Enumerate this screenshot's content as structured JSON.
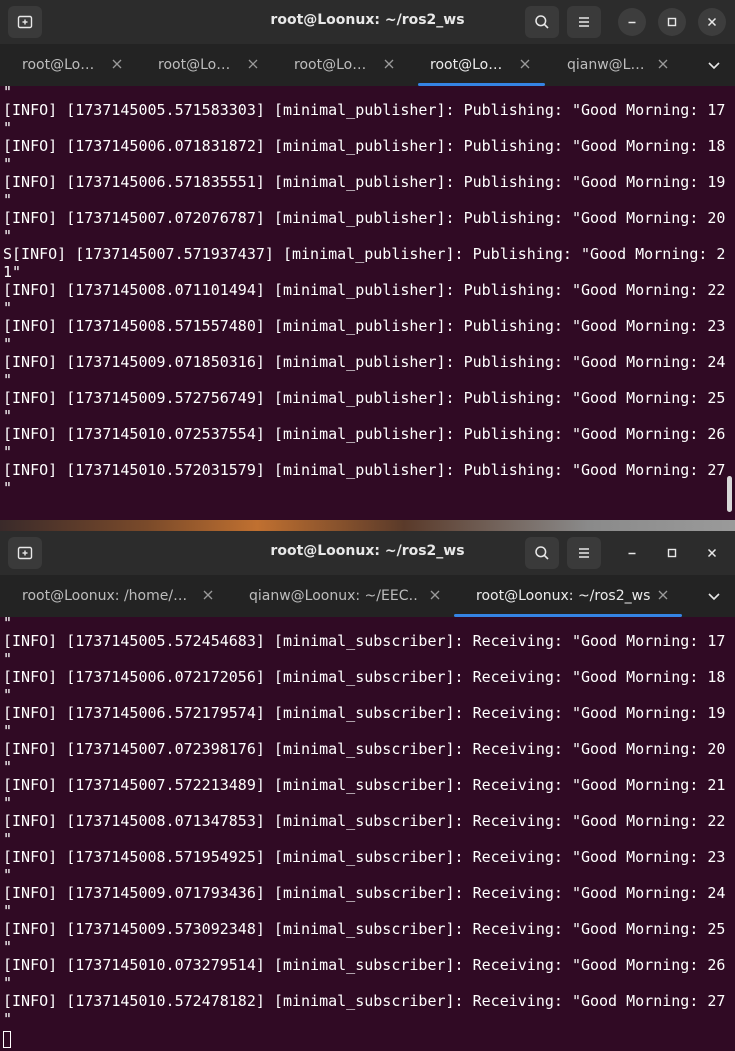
{
  "top_window": {
    "title": "root@Loonux: ~/ros2_ws",
    "tabs": [
      {
        "label": "root@Lo…",
        "active": false
      },
      {
        "label": "root@Lo…",
        "active": false
      },
      {
        "label": "root@Lo…",
        "active": false
      },
      {
        "label": "root@Lo…",
        "active": true
      },
      {
        "label": "qianw@L…",
        "active": false
      }
    ],
    "lines": [
      "\"",
      "[INFO] [1737145005.571583303] [minimal_publisher]: Publishing: \"Good Morning: 17",
      "\"",
      "[INFO] [1737145006.071831872] [minimal_publisher]: Publishing: \"Good Morning: 18",
      "\"",
      "[INFO] [1737145006.571835551] [minimal_publisher]: Publishing: \"Good Morning: 19",
      "\"",
      "[INFO] [1737145007.072076787] [minimal_publisher]: Publishing: \"Good Morning: 20",
      "\"",
      "S[INFO] [1737145007.571937437] [minimal_publisher]: Publishing: \"Good Morning: 2",
      "1\"",
      "[INFO] [1737145008.071101494] [minimal_publisher]: Publishing: \"Good Morning: 22",
      "\"",
      "[INFO] [1737145008.571557480] [minimal_publisher]: Publishing: \"Good Morning: 23",
      "\"",
      "[INFO] [1737145009.071850316] [minimal_publisher]: Publishing: \"Good Morning: 24",
      "\"",
      "[INFO] [1737145009.572756749] [minimal_publisher]: Publishing: \"Good Morning: 25",
      "\"",
      "[INFO] [1737145010.072537554] [minimal_publisher]: Publishing: \"Good Morning: 26",
      "\"",
      "[INFO] [1737145010.572031579] [minimal_publisher]: Publishing: \"Good Morning: 27",
      "\""
    ]
  },
  "bottom_window": {
    "title": "root@Loonux: ~/ros2_ws",
    "tabs": [
      {
        "label": "root@Loonux: /home/…",
        "active": false
      },
      {
        "label": "qianw@Loonux: ~/EEC…",
        "active": false
      },
      {
        "label": "root@Loonux: ~/ros2_ws",
        "active": true
      }
    ],
    "lines": [
      "\"",
      "[INFO] [1737145005.572454683] [minimal_subscriber]: Receiving: \"Good Morning: 17",
      "\"",
      "[INFO] [1737145006.072172056] [minimal_subscriber]: Receiving: \"Good Morning: 18",
      "\"",
      "[INFO] [1737145006.572179574] [minimal_subscriber]: Receiving: \"Good Morning: 19",
      "\"",
      "[INFO] [1737145007.072398176] [minimal_subscriber]: Receiving: \"Good Morning: 20",
      "\"",
      "[INFO] [1737145007.572213489] [minimal_subscriber]: Receiving: \"Good Morning: 21",
      "\"",
      "[INFO] [1737145008.071347853] [minimal_subscriber]: Receiving: \"Good Morning: 22",
      "\"",
      "[INFO] [1737145008.571954925] [minimal_subscriber]: Receiving: \"Good Morning: 23",
      "\"",
      "[INFO] [1737145009.071793436] [minimal_subscriber]: Receiving: \"Good Morning: 24",
      "\"",
      "[INFO] [1737145009.573092348] [minimal_subscriber]: Receiving: \"Good Morning: 25",
      "\"",
      "[INFO] [1737145010.073279514] [minimal_subscriber]: Receiving: \"Good Morning: 26",
      "\"",
      "[INFO] [1737145010.572478182] [minimal_subscriber]: Receiving: \"Good Morning: 27",
      "\""
    ]
  },
  "colors": {
    "terminal_bg": "#300a24",
    "titlebar_bg": "#2c2c2c",
    "tabbar_bg": "#232323",
    "tab_accent": "#3584e4",
    "text": "#ffffff"
  },
  "icons": [
    "new-tab-icon",
    "search-icon",
    "hamburger-menu-icon",
    "minimize-icon",
    "maximize-icon",
    "close-icon",
    "tab-close-icon",
    "tab-overflow-chevron-icon"
  ]
}
